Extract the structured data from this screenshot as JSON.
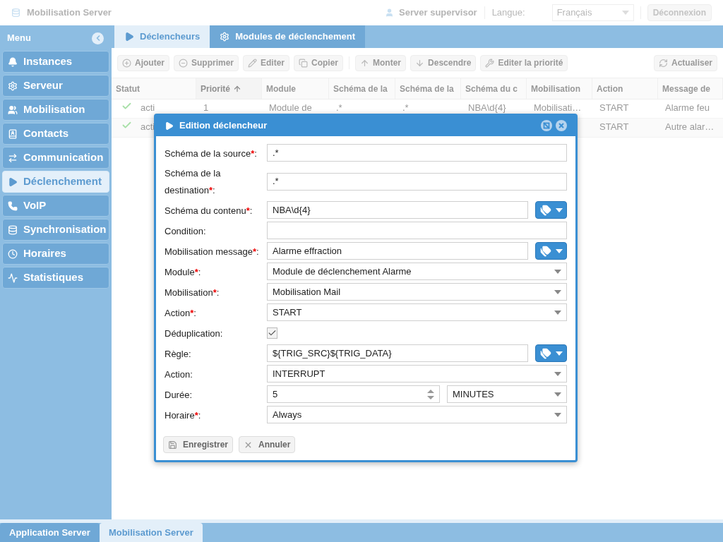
{
  "header": {
    "app_title": "Mobilisation Server",
    "user": "Server supervisor",
    "language_label": "Langue:",
    "language": "Français",
    "logout": "Déconnexion"
  },
  "sidebar": {
    "title": "Menu",
    "items": [
      {
        "label": "Instances",
        "selected": false
      },
      {
        "label": "Serveur",
        "selected": false
      },
      {
        "label": "Mobilisation",
        "selected": false
      },
      {
        "label": "Contacts",
        "selected": false
      },
      {
        "label": "Communication",
        "selected": false
      },
      {
        "label": "Déclenchement",
        "selected": true
      },
      {
        "label": "VoIP",
        "selected": false
      },
      {
        "label": "Synchronisation",
        "selected": false
      },
      {
        "label": "Horaires",
        "selected": false
      },
      {
        "label": "Statistiques",
        "selected": false
      }
    ]
  },
  "tabs": [
    {
      "label": "Déclencheurs",
      "selected": true
    },
    {
      "label": "Modules de déclenchement",
      "selected": false
    }
  ],
  "toolbar": [
    "Ajouter",
    "Supprimer",
    "Editer",
    "Copier",
    "Monter",
    "Descendre",
    "Editer la priorité",
    "Actualiser"
  ],
  "table": {
    "columns": [
      {
        "label": "Statut",
        "sorted": false
      },
      {
        "label": "Priorité",
        "sorted": true
      },
      {
        "label": "Module",
        "sorted": false
      },
      {
        "label": "Schéma de la",
        "sorted": false
      },
      {
        "label": "Schéma de la",
        "sorted": false
      },
      {
        "label": "Schéma du c",
        "sorted": false
      },
      {
        "label": "Mobilisation",
        "sorted": false
      },
      {
        "label": "Action",
        "sorted": false
      },
      {
        "label": "Message de",
        "sorted": false
      }
    ],
    "rows": [
      {
        "cells": [
          "acti",
          "1",
          "Module de",
          ".*",
          ".*",
          "NBA\\d{4}",
          "Mobilisati…",
          "START",
          "Alarme feu"
        ]
      },
      {
        "cells": [
          "acti",
          null,
          null,
          null,
          null,
          null,
          null,
          "START",
          "Autre alar…"
        ]
      }
    ]
  },
  "dialog": {
    "title": "Edition déclencheur",
    "fields": [
      {
        "kind": "text",
        "label": "Schéma de la source",
        "mark": "*",
        "value": ".*"
      },
      {
        "kind": "text",
        "label": "Schéma de la destination",
        "mark": "*",
        "value": ".*"
      },
      {
        "kind": "tagtext",
        "label": "Schéma du contenu",
        "mark": "*",
        "value": "NBA\\d{4}"
      },
      {
        "kind": "text",
        "label": "Condition"
      },
      {
        "kind": "tagtext",
        "label": "Mobilisation message",
        "mark": "*",
        "value": "Alarme effraction"
      },
      {
        "kind": "select",
        "label": "Module",
        "mark": "*",
        "value": "Module de déclenchement Alarme"
      },
      {
        "kind": "select",
        "label": "Mobilisation",
        "mark": "*",
        "value": "Mobilisation Mail"
      },
      {
        "kind": "select",
        "label": "Action",
        "mark": "*",
        "value": "START"
      },
      {
        "kind": "checkbox",
        "label": "Déduplication",
        "checked": true
      },
      {
        "kind": "tagtext",
        "label": "Règle",
        "value": "${TRIG_SRC}${TRIG_DATA}"
      },
      {
        "kind": "select",
        "label": "Action",
        "value": "INTERRUPT"
      },
      {
        "kind": "duration",
        "label": "Durée",
        "value": "5",
        "unit": "MINUTES"
      },
      {
        "kind": "select",
        "label": "Horaire",
        "mark": "*",
        "value": "Always"
      }
    ],
    "colon": ":",
    "buttons": [
      "Enregistrer",
      "Annuler"
    ]
  },
  "bottom_tabs": [
    {
      "label": "Application Server",
      "selected": false
    },
    {
      "label": "Mobilisation Server",
      "selected": true
    }
  ]
}
